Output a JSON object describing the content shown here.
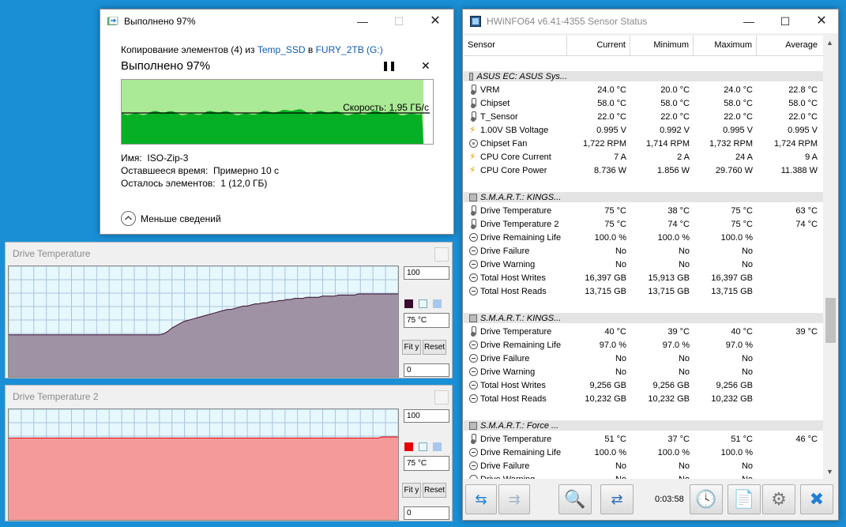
{
  "copy_dialog": {
    "title": "Выполнено 97%",
    "line_prefix": "Копирование элементов (4) из ",
    "source": "Temp_SSD",
    "line_mid": " в ",
    "dest": "FURY_2TB (G:)",
    "progress_heading": "Выполнено 97%",
    "progress": 0.97,
    "speed": "Скорость: 1,95 ГБ/с",
    "name_label": "Имя:",
    "name_value": "ISO-Zip-3",
    "remaining_label": "Оставшееся время:",
    "remaining_value": "Примерно 10 с",
    "items_label": "Осталось элементов:",
    "items_value": "1 (12,0 ГБ)",
    "less_details": "Меньше сведений",
    "colors": {
      "done_fill": "#06b025",
      "bg_fill": "#aaea96",
      "speed_line": "#000000"
    }
  },
  "graph1": {
    "title": "Drive Temperature",
    "max": "100",
    "current": "75 °C",
    "min": "0",
    "fit_label": "Fit y",
    "reset_label": "Reset",
    "fill_color": "#9f92a4",
    "swatch": "#3a0d2e",
    "samples": [
      38,
      38,
      38,
      38,
      38,
      38,
      38,
      38,
      38,
      38,
      38,
      38,
      38,
      38,
      38,
      38,
      38,
      38,
      38,
      38,
      38,
      38,
      38,
      38,
      38,
      38,
      38,
      38,
      38,
      38,
      38,
      38,
      38,
      38,
      38,
      38,
      38,
      38,
      38,
      39,
      41,
      44,
      46,
      48,
      50,
      51,
      52,
      53,
      54,
      55,
      56,
      57,
      58,
      59,
      60,
      61,
      61,
      62,
      63,
      64,
      64,
      65,
      66,
      66,
      67,
      67,
      68,
      68,
      69,
      69,
      70,
      70,
      71,
      71,
      71,
      72,
      72,
      72,
      72,
      73,
      73,
      73,
      73,
      74,
      74,
      74,
      74,
      74,
      75,
      75,
      75,
      75,
      75,
      75,
      75,
      75,
      75,
      75,
      75
    ]
  },
  "graph2": {
    "title": "Drive Temperature 2",
    "max": "100",
    "current": "75 °C",
    "min": "0",
    "fit_label": "Fit y",
    "reset_label": "Reset",
    "fill_color": "#f49a9a",
    "swatch": "#e60000",
    "samples": [
      74,
      74,
      74,
      74,
      74,
      74,
      74,
      74,
      74,
      74,
      74,
      74,
      74,
      74,
      74,
      74,
      74,
      74,
      74,
      74,
      74,
      74,
      74,
      74,
      74,
      74,
      74,
      74,
      74,
      74,
      74,
      74,
      74,
      74,
      74,
      74,
      74,
      74,
      74,
      74,
      74,
      74,
      74,
      74,
      74,
      74,
      74,
      74,
      74,
      74,
      74,
      74,
      74,
      74,
      74,
      74,
      74,
      74,
      74,
      74,
      74,
      74,
      74,
      74,
      74,
      74,
      74,
      74,
      74,
      74,
      74,
      74,
      74,
      74,
      74,
      74,
      74,
      74,
      74,
      74,
      74,
      74,
      74,
      74,
      74,
      74,
      74,
      74,
      74,
      74,
      74,
      74,
      74,
      74,
      75,
      75,
      75,
      75,
      75
    ]
  },
  "hwinfo": {
    "title": "HWiNFO64 v6.41-4355 Sensor Status",
    "headers": [
      "Sensor",
      "Current",
      "Minimum",
      "Maximum",
      "Average"
    ],
    "timer": "0:03:58",
    "rows": [
      {
        "t": "spacer"
      },
      {
        "t": "group",
        "name": "ASUS EC: ASUS Sys..."
      },
      {
        "t": "row",
        "icon": "therm",
        "name": "VRM",
        "v": [
          "24.0 °C",
          "20.0 °C",
          "24.0 °C",
          "22.8 °C"
        ]
      },
      {
        "t": "row",
        "icon": "therm",
        "name": "Chipset",
        "v": [
          "58.0 °C",
          "58.0 °C",
          "58.0 °C",
          "58.0 °C"
        ]
      },
      {
        "t": "row",
        "icon": "therm",
        "name": "T_Sensor",
        "v": [
          "22.0 °C",
          "22.0 °C",
          "22.0 °C",
          "22.0 °C"
        ]
      },
      {
        "t": "row",
        "icon": "volt",
        "name": "1.00V SB Voltage",
        "v": [
          "0.995 V",
          "0.992 V",
          "0.995 V",
          "0.995 V"
        ]
      },
      {
        "t": "row",
        "icon": "fan",
        "name": "Chipset Fan",
        "v": [
          "1,722 RPM",
          "1,714 RPM",
          "1,732 RPM",
          "1,724 RPM"
        ]
      },
      {
        "t": "row",
        "icon": "volt",
        "name": "CPU Core Current",
        "v": [
          "7 A",
          "2 A",
          "24 A",
          "9 A"
        ]
      },
      {
        "t": "row",
        "icon": "volt",
        "name": "CPU Core Power",
        "v": [
          "8.736 W",
          "1.856 W",
          "29.760 W",
          "11.388 W"
        ]
      },
      {
        "t": "spacer"
      },
      {
        "t": "group",
        "name": "S.M.A.R.T.: KINGS..."
      },
      {
        "t": "row",
        "icon": "therm",
        "name": "Drive Temperature",
        "v": [
          "75 °C",
          "38 °C",
          "75 °C",
          "63 °C"
        ]
      },
      {
        "t": "row",
        "icon": "therm",
        "name": "Drive Temperature 2",
        "v": [
          "75 °C",
          "74 °C",
          "75 °C",
          "74 °C"
        ]
      },
      {
        "t": "row",
        "icon": "gauge",
        "name": "Drive Remaining Life",
        "v": [
          "100.0 %",
          "100.0 %",
          "100.0 %",
          ""
        ]
      },
      {
        "t": "row",
        "icon": "gauge",
        "name": "Drive Failure",
        "v": [
          "No",
          "No",
          "No",
          ""
        ]
      },
      {
        "t": "row",
        "icon": "gauge",
        "name": "Drive Warning",
        "v": [
          "No",
          "No",
          "No",
          ""
        ]
      },
      {
        "t": "row",
        "icon": "gauge",
        "name": "Total Host Writes",
        "v": [
          "16,397 GB",
          "15,913 GB",
          "16,397 GB",
          ""
        ]
      },
      {
        "t": "row",
        "icon": "gauge",
        "name": "Total Host Reads",
        "v": [
          "13,715 GB",
          "13,715 GB",
          "13,715 GB",
          ""
        ]
      },
      {
        "t": "spacer"
      },
      {
        "t": "group",
        "name": "S.M.A.R.T.: KINGS..."
      },
      {
        "t": "row",
        "icon": "therm",
        "name": "Drive Temperature",
        "v": [
          "40 °C",
          "39 °C",
          "40 °C",
          "39 °C"
        ]
      },
      {
        "t": "row",
        "icon": "gauge",
        "name": "Drive Remaining Life",
        "v": [
          "97.0 %",
          "97.0 %",
          "97.0 %",
          ""
        ]
      },
      {
        "t": "row",
        "icon": "gauge",
        "name": "Drive Failure",
        "v": [
          "No",
          "No",
          "No",
          ""
        ]
      },
      {
        "t": "row",
        "icon": "gauge",
        "name": "Drive Warning",
        "v": [
          "No",
          "No",
          "No",
          ""
        ]
      },
      {
        "t": "row",
        "icon": "gauge",
        "name": "Total Host Writes",
        "v": [
          "9,256 GB",
          "9,256 GB",
          "9,256 GB",
          ""
        ]
      },
      {
        "t": "row",
        "icon": "gauge",
        "name": "Total Host Reads",
        "v": [
          "10,232 GB",
          "10,232 GB",
          "10,232 GB",
          ""
        ]
      },
      {
        "t": "spacer"
      },
      {
        "t": "group",
        "name": "S.M.A.R.T.: Force ..."
      },
      {
        "t": "row",
        "icon": "therm",
        "name": "Drive Temperature",
        "v": [
          "51 °C",
          "37 °C",
          "51 °C",
          "46 °C"
        ]
      },
      {
        "t": "row",
        "icon": "gauge",
        "name": "Drive Remaining Life",
        "v": [
          "100.0 %",
          "100.0 %",
          "100.0 %",
          ""
        ]
      },
      {
        "t": "row",
        "icon": "gauge",
        "name": "Drive Failure",
        "v": [
          "No",
          "No",
          "No",
          ""
        ]
      },
      {
        "t": "row",
        "icon": "gauge",
        "name": "Drive Warning",
        "v": [
          "No",
          "No",
          "No",
          ""
        ]
      }
    ],
    "toolbar_icons": [
      "nav-arrows-icon",
      "nav-arrows-disabled-icon",
      "sensor-search-icon",
      "network-icon",
      "clock-icon",
      "add-report-icon",
      "settings-gear-icon",
      "close-x-icon"
    ]
  }
}
